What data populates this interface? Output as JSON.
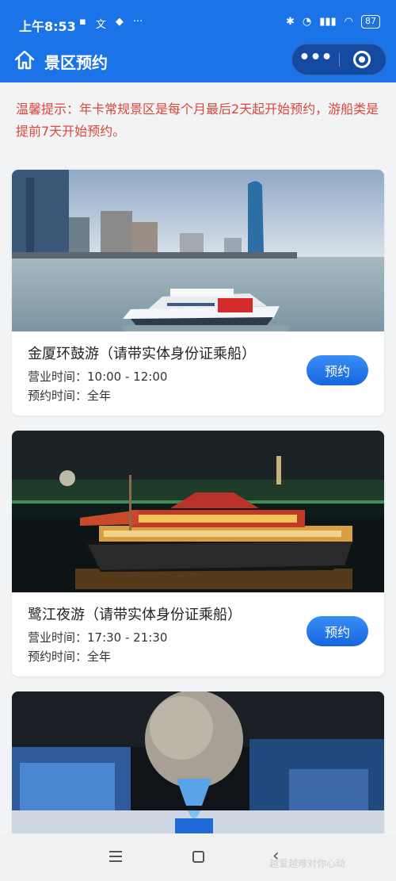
{
  "status_bar": {
    "time": "上午8:53",
    "battery": "87"
  },
  "navbar": {
    "title": "景区预约",
    "more_icon": "more-dots-icon",
    "close_icon": "target-circle-icon"
  },
  "notice": "温馨提示：年卡常规景区是每个月最后2天起开始预约，游船类是提前7天开始预约。",
  "cards": [
    {
      "title": "金厦环鼓游（请带实体身份证乘船）",
      "hours": "营业时间：10:00 - 12:00",
      "booking": "预约时间：全年",
      "button": "预约",
      "image": "day-harbor-ferry-photo"
    },
    {
      "title": "鹭江夜游（请带实体身份证乘船）",
      "hours": "营业时间：17:30 - 21:30",
      "booking": "预约时间：全年",
      "button": "预约",
      "image": "night-river-cruise-photo"
    },
    {
      "image": "museum-globe-exhibit-photo"
    }
  ],
  "watermark": "越爱越难对你心动",
  "colors": {
    "primary": "#1b73e8",
    "notice_red": "#d9483b",
    "button_blue": "#1f6fe5"
  }
}
